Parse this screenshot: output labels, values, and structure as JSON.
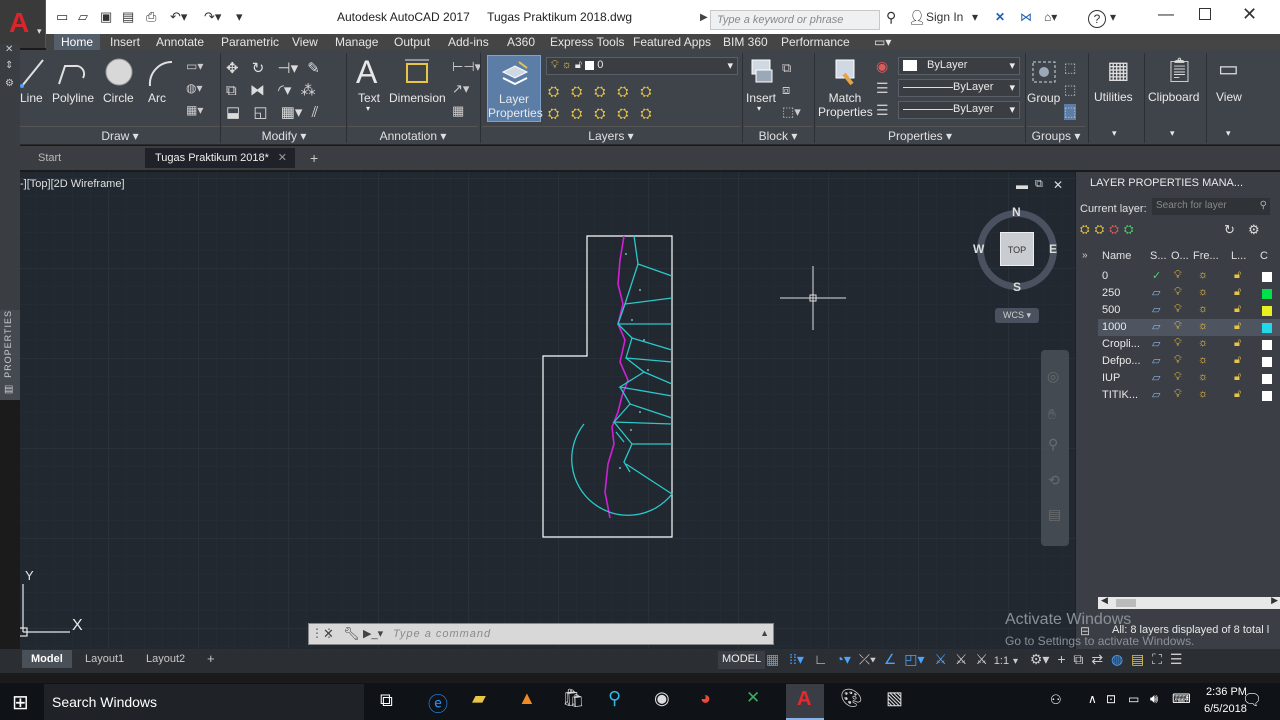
{
  "window": {
    "app_title": "Autodesk AutoCAD 2017",
    "file_title": "Tugas Praktikum 2018.dwg",
    "search_placeholder": "Type a keyword or phrase",
    "sign_in": "Sign In",
    "help": "?"
  },
  "ribbon_tabs": [
    "Home",
    "Insert",
    "Annotate",
    "Parametric",
    "View",
    "Manage",
    "Output",
    "Add-ins",
    "A360",
    "Express Tools",
    "Featured Apps",
    "BIM 360",
    "Performance"
  ],
  "ribbon": {
    "draw": {
      "title": "Draw",
      "line": "Line",
      "polyline": "Polyline",
      "circle": "Circle",
      "arc": "Arc"
    },
    "modify": {
      "title": "Modify"
    },
    "annotation": {
      "title": "Annotation",
      "text": "Text",
      "dimension": "Dimension"
    },
    "layers": {
      "title": "Layers",
      "layer_properties_1": "Layer",
      "layer_properties_2": "Properties",
      "current_layer": "0"
    },
    "block": {
      "title": "Block",
      "insert": "Insert"
    },
    "properties": {
      "title": "Properties",
      "match_1": "Match",
      "match_2": "Properties",
      "color": "ByLayer",
      "linetype": "ByLayer",
      "lineweight": "ByLayer"
    },
    "groups": {
      "title": "Groups",
      "group": "Group"
    },
    "utilities": "Utilities",
    "clipboard": "Clipboard",
    "view": "View"
  },
  "doc_tabs": {
    "start": "Start",
    "active": "Tugas Praktikum 2018*"
  },
  "viewport": {
    "label": "-][Top][2D Wireframe]",
    "viewcube_face": "TOP",
    "north": "N",
    "south": "S",
    "east": "E",
    "west": "W",
    "wcs": "WCS",
    "ucs_y": "Y",
    "ucs_x": "X"
  },
  "side_panel_label": "PROPERTIES",
  "layer_panel": {
    "title": "LAYER PROPERTIES MANA...",
    "current_layer_label": "Current layer:",
    "search_placeholder": "Search for layer",
    "columns": [
      "Name",
      "S...",
      "O...",
      "Fre...",
      "L...",
      "C"
    ],
    "layers": [
      {
        "name": "0",
        "color": "#ffffff",
        "current": true
      },
      {
        "name": "250",
        "color": "#00e04a",
        "current": false
      },
      {
        "name": "500",
        "color": "#e8f020",
        "current": false
      },
      {
        "name": "1000",
        "color": "#22d8e8",
        "current": false,
        "selected": true
      },
      {
        "name": "Cropli...",
        "color": "#ffffff",
        "current": false
      },
      {
        "name": "Defpo...",
        "color": "#ffffff",
        "current": false
      },
      {
        "name": "IUP",
        "color": "#ffffff",
        "current": false
      },
      {
        "name": "TITIK...",
        "color": "#ffffff",
        "current": false
      }
    ],
    "status": "All: 8 layers displayed of 8 total l"
  },
  "command_placeholder": "Type a command",
  "layout_tabs": [
    "Model",
    "Layout1",
    "Layout2"
  ],
  "status": {
    "model": "MODEL",
    "scale": "1:1"
  },
  "watermark": {
    "line1": "Activate Windows",
    "line2": "Go to Settings to activate Windows."
  },
  "taskbar": {
    "search": "Search Windows",
    "time": "2:36 PM",
    "date": "6/5/2018"
  }
}
